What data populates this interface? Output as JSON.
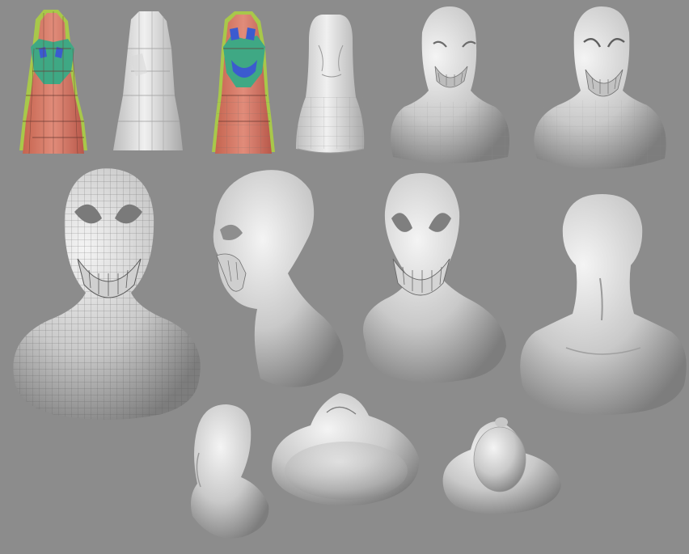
{
  "image": {
    "background_color": "#8c8c8c",
    "surface_color": "#e2e2e2",
    "model_colors": {
      "body": "#d9786a",
      "face_mask": "#3fa884",
      "eye_ring": "#3b5bcf",
      "border": "#a8c84a",
      "wire": "#6a6a6a"
    },
    "rows": [
      {
        "name": "modeling-progression-row",
        "items": [
          "colored-blockout",
          "gray-blockout",
          "colored-face-blockout",
          "smoothed-blockout",
          "bust-with-shoulders",
          "smoothed-bust"
        ]
      },
      {
        "name": "sculpt-views-row",
        "items": [
          "wireframe-bust",
          "side-view-sculpt",
          "front-view-sculpt",
          "back-view-sculpt"
        ]
      },
      {
        "name": "additional-views-row",
        "items": [
          "three-quarter-back-view",
          "bottom-view",
          "top-view"
        ]
      }
    ]
  }
}
